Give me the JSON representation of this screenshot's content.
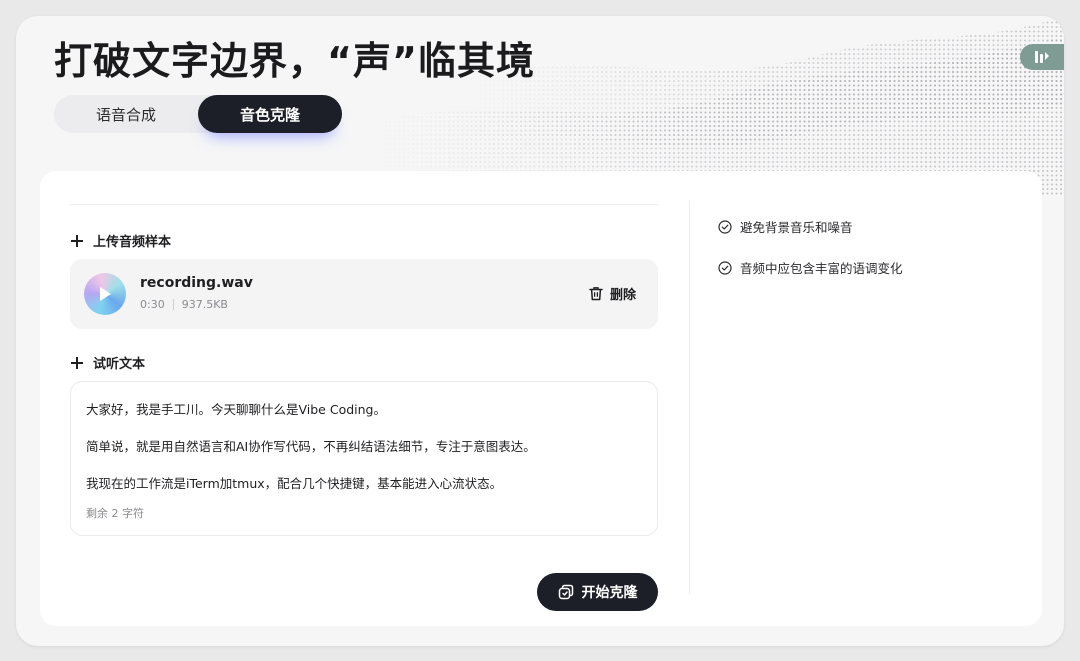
{
  "header": {
    "title": "打破文字边界，“声”临其境"
  },
  "mode_tabs": [
    {
      "label": "语音合成",
      "active": false
    },
    {
      "label": "音色克隆",
      "active": true
    }
  ],
  "upload": {
    "section_label": "上传音频样本",
    "file_name": "recording.wav",
    "duration": "0:30",
    "file_size": "937.5KB",
    "delete_label": "删除"
  },
  "preview_text": {
    "section_label": "试听文本",
    "lines": [
      "大家好，我是手工川。今天聊聊什么是Vibe Coding。",
      "简单说，就是用自然语言和AI协作写代码，不再纠结语法细节，专注于意图表达。",
      "我现在的工作流是iTerm加tmux，配合几个快捷键，基本能进入心流状态。"
    ],
    "remaining": "剩余 2 字符"
  },
  "actions": {
    "start_clone_label": "开始克隆"
  },
  "tips": [
    "避免背景音乐和噪音",
    "音频中应包含丰富的语调变化"
  ],
  "icons": {
    "plus": "plus-icon",
    "play": "play-icon",
    "trash": "trash-icon",
    "clone": "clone-icon",
    "check": "check-circle-icon",
    "logo": "brand-logo-icon"
  },
  "colors": {
    "primary_dark": "#1c1f27",
    "logo_badge": "#7f9c94",
    "muted_text": "#8b8b90"
  }
}
